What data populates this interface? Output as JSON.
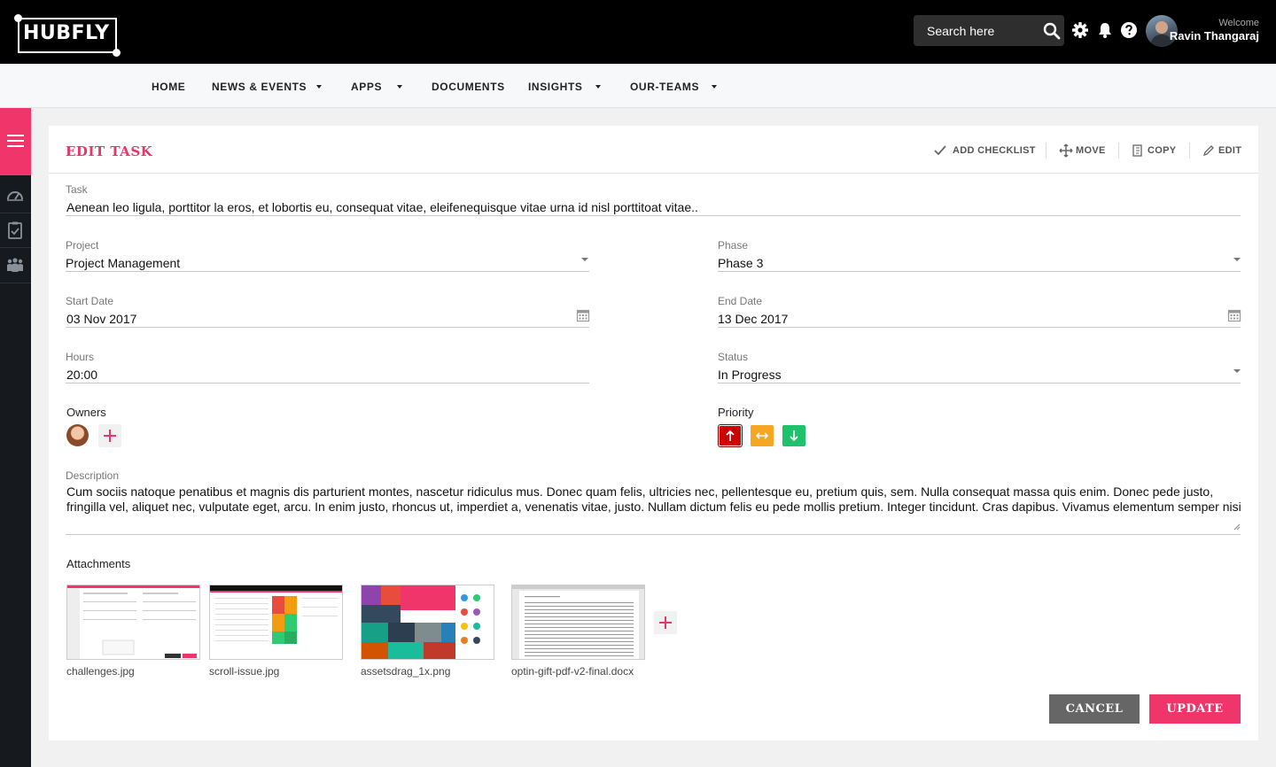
{
  "app": {
    "logo": "HUBFLY"
  },
  "header": {
    "search_placeholder": "Search here",
    "icons": [
      "search-icon",
      "gear-icon",
      "bell-icon",
      "help-icon"
    ],
    "welcome": "Welcome",
    "username": "Ravin Thangaraj"
  },
  "nav": {
    "items": [
      {
        "label": "HOME",
        "dropdown": false
      },
      {
        "label": "NEWS & EVENTS",
        "dropdown": true
      },
      {
        "label": "APPS",
        "dropdown": true
      },
      {
        "label": "DOCUMENTS",
        "dropdown": false
      },
      {
        "label": "INSIGHTS",
        "dropdown": true
      },
      {
        "label": "OUR-TEAMS",
        "dropdown": true
      }
    ]
  },
  "sidebar": {
    "icons": [
      "menu-icon",
      "dashboard-icon",
      "clipboard-check-icon",
      "team-icon"
    ]
  },
  "card": {
    "title": "EDIT TASK",
    "actions": {
      "add_checklist": "ADD CHECKLIST",
      "move": "MOVE",
      "copy": "COPY",
      "edit": "EDIT"
    }
  },
  "form": {
    "task": {
      "label": "Task",
      "value": "Aenean leo ligula, porttitor la eros, et lobortis eu, consequat vitae, eleifenequisque vitae urna id nisl porttitoat vitae.."
    },
    "project": {
      "label": "Project",
      "value": "Project Management"
    },
    "phase": {
      "label": "Phase",
      "value": "Phase 3"
    },
    "start_date": {
      "label": "Start Date",
      "value": "03 Nov 2017"
    },
    "end_date": {
      "label": "End Date",
      "value": "13 Dec 2017"
    },
    "hours": {
      "label": "Hours",
      "value": "20:00"
    },
    "status": {
      "label": "Status",
      "value": "In Progress"
    },
    "owners": {
      "label": "Owners"
    },
    "priority": {
      "label": "Priority",
      "levels": [
        {
          "name": "high",
          "color": "#cc0000",
          "selected": true
        },
        {
          "name": "medium",
          "color": "#f5a623",
          "selected": false
        },
        {
          "name": "low",
          "color": "#1ec26b",
          "selected": false
        }
      ]
    },
    "description": {
      "label": "Description",
      "value": "Cum sociis natoque penatibus et magnis dis parturient montes, nascetur ridiculus mus. Donec quam felis, ultricies nec, pellentesque eu, pretium quis, sem. Nulla consequat massa quis enim. Donec pede justo, fringilla vel, aliquet nec, vulputate eget, arcu. In enim justo, rhoncus ut, imperdiet a, venenatis vitae, justo. Nullam dictum felis eu pede mollis pretium. Integer tincidunt. Cras dapibus. Vivamus elementum semper nisi"
    },
    "attachments": {
      "label": "Attachments",
      "files": [
        {
          "name": "challenges.jpg"
        },
        {
          "name": "scroll-issue.jpg"
        },
        {
          "name": "assetsdrag_1x.png"
        },
        {
          "name": "optin-gift-pdf-v2-final.docx"
        }
      ]
    }
  },
  "buttons": {
    "cancel": "CANCEL",
    "update": "UPDATE"
  },
  "colors": {
    "accent": "#e9356a",
    "header_bg": "#000000",
    "sidebar_bg": "#161a1f",
    "cancel_bg": "#666666",
    "update_bg": "#f0356a"
  }
}
